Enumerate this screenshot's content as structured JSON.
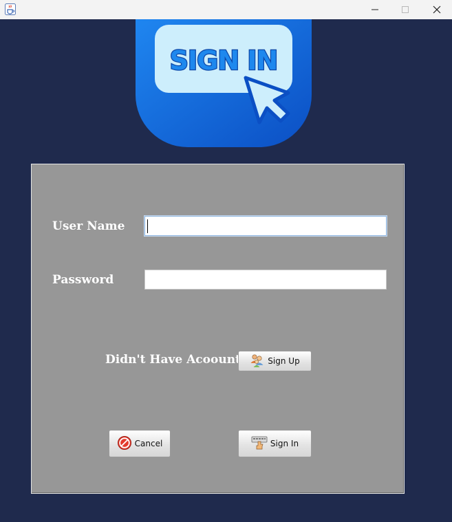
{
  "window": {
    "title": ""
  },
  "logo": {
    "text": "SIGN IN"
  },
  "form": {
    "username_label": "User Name",
    "username_value": "",
    "password_label": "Password",
    "password_value": "",
    "no_account_text": "Didn't Have Acoount",
    "signup_label": "Sign Up",
    "cancel_label": "Cancel",
    "signin_label": "Sign In"
  },
  "icons": {
    "app": "java-cup-icon",
    "minimize": "minimize-icon",
    "maximize": "maximize-icon",
    "close": "close-icon",
    "signup": "users-icon",
    "cancel": "no-entry-icon",
    "signin": "keyboard-hand-icon"
  },
  "colors": {
    "background": "#1f2a4d",
    "panel": "#979797",
    "logo_blue": "#1565d8",
    "logo_box": "#cdeefc"
  }
}
